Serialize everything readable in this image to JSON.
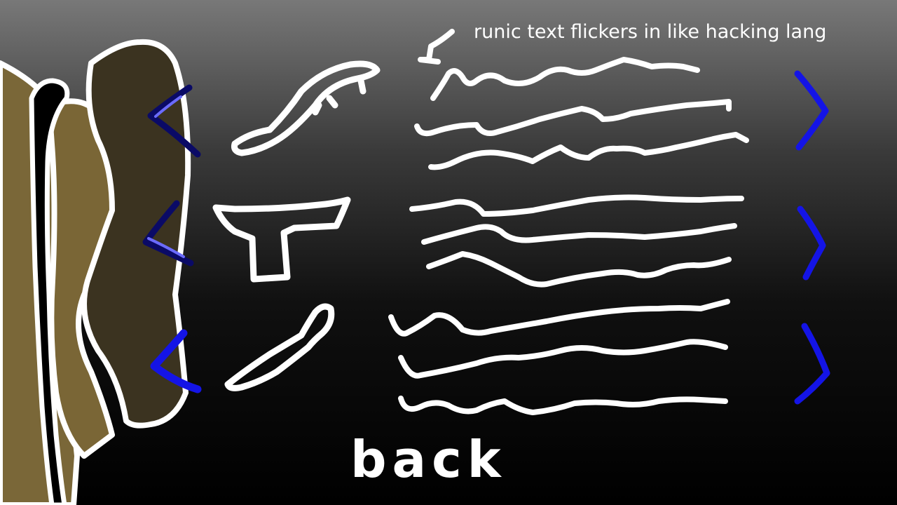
{
  "annotation": "runic text flickers in like hacking lang",
  "back_label": "back",
  "colors": {
    "panel_dark": "#3b3320",
    "panel_mid": "#7a6636",
    "panel_light": "#7a6738",
    "strap": "#000000",
    "outline": "#ffffff",
    "arrow_blue": "#1414e6",
    "arrow_navy": "#0a0a66",
    "arrow_violet": "#6b6bff"
  },
  "slots": [
    {
      "icon": "sword-icon"
    },
    {
      "icon": "pistol-icon"
    },
    {
      "icon": "staff-icon"
    }
  ]
}
